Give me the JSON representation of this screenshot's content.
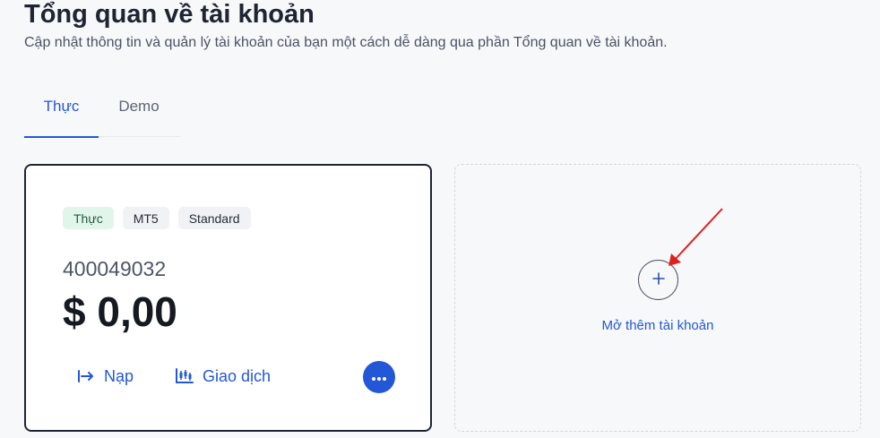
{
  "header": {
    "title": "Tổng quan về tài khoản",
    "subtitle": "Cập nhật thông tin và quản lý tài khoản của bạn một cách dễ dàng qua phần Tổng quan về tài khoản."
  },
  "tabs": [
    {
      "label": "Thực",
      "active": true
    },
    {
      "label": "Demo",
      "active": false
    }
  ],
  "account": {
    "badges": [
      "Thực",
      "MT5",
      "Standard"
    ],
    "number": "400049032",
    "balance": "$ 0,00",
    "actions": {
      "deposit_label": "Nạp",
      "deposit_icon": "arrow-right-to-bar-icon",
      "trade_label": "Giao dịch",
      "trade_icon": "candlestick-chart-icon",
      "more_icon": "more-dots-icon"
    }
  },
  "add_account": {
    "label": "Mở thêm tài khoản",
    "icon": "plus-icon"
  },
  "colors": {
    "accent": "#2457d6",
    "real_badge_bg": "#e2f5ea",
    "annotation_arrow": "#e02020"
  }
}
